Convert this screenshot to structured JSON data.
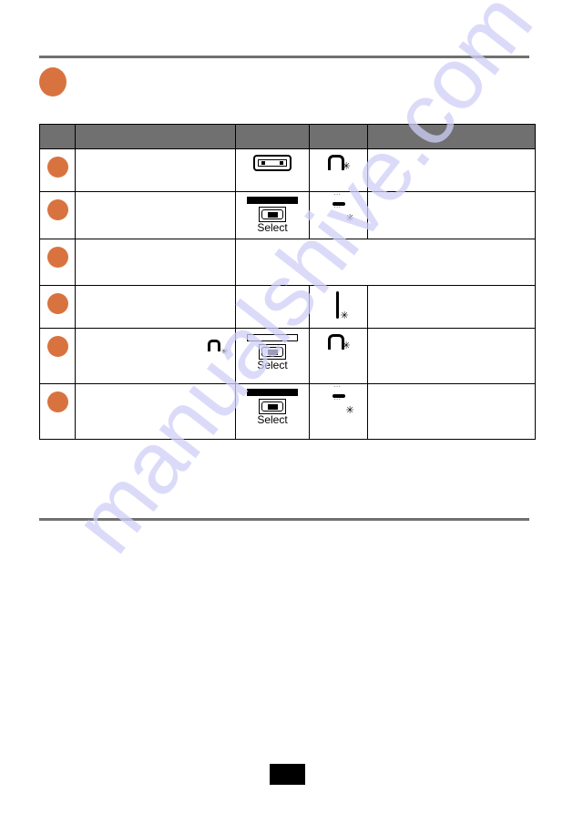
{
  "page": {
    "accent_color": "#d8733f",
    "rule_color": "#707070",
    "watermark": "manualshive.com",
    "page_number": ""
  },
  "section": {
    "bullet_icon": "orange-circle-bullet",
    "title": ""
  },
  "table": {
    "headers": [
      "",
      "",
      "",
      "",
      ""
    ],
    "rows": [
      {
        "step_icon": "orange-circle",
        "description": "",
        "switch_icon": "jumper-icon",
        "switch_label": "",
        "display_icon": "n-segment-with-light-icon",
        "display_text": "",
        "notes": ""
      },
      {
        "step_icon": "orange-circle",
        "description": "",
        "switch_icon": "select-switch-filled-icon",
        "switch_label": "Select",
        "display_icon": "blinking-dash-with-light-icon",
        "display_text": "",
        "notes": ""
      },
      {
        "step_icon": "orange-circle",
        "description": "",
        "merged_text": ""
      },
      {
        "step_icon": "orange-circle",
        "description": "",
        "switch_icon": "",
        "switch_label": "",
        "display_icon": "digit-one-with-light-icon",
        "display_text": "",
        "notes": ""
      },
      {
        "step_icon": "orange-circle",
        "description": "",
        "inline_icon": "n-segment-with-light-icon",
        "switch_icon": "select-switch-empty-icon",
        "switch_label": "Select",
        "display_icon": "n-segment-with-light-icon",
        "display_text": "",
        "notes": ""
      },
      {
        "step_icon": "orange-circle",
        "description": "",
        "switch_icon": "select-switch-filled-icon",
        "switch_label": "Select",
        "display_icon": "blinking-dash-with-light-icon",
        "display_text": "",
        "notes": ""
      }
    ]
  },
  "glyphs": {
    "light": "✳",
    "blink_top": "˙˙˙",
    "blink_bottom": "˙˙˙"
  }
}
